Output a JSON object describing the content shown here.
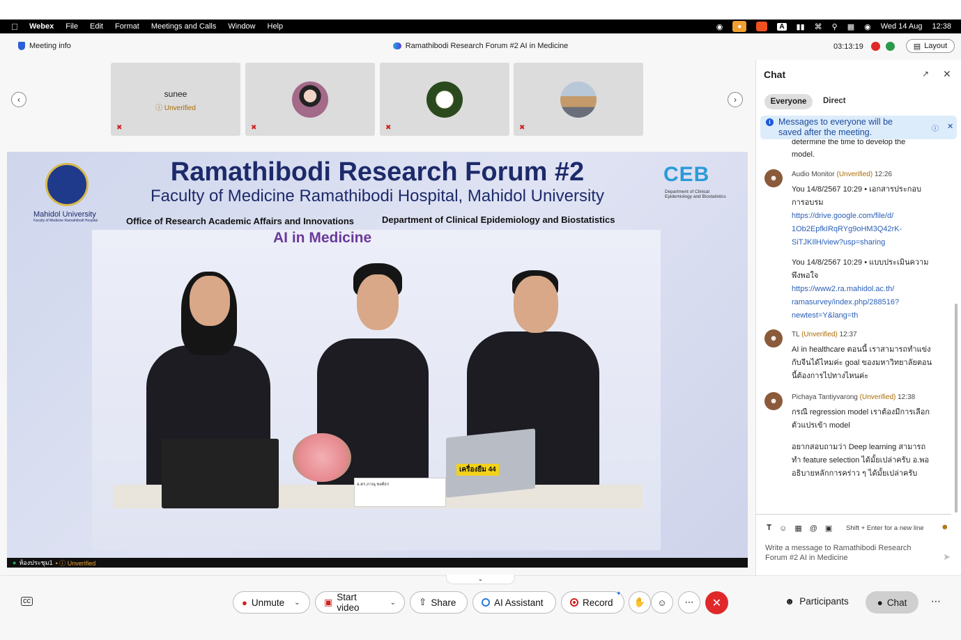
{
  "menubar": {
    "app": "Webex",
    "items": [
      "File",
      "Edit",
      "Format",
      "Meetings and Calls",
      "Window",
      "Help"
    ],
    "date": "Wed 14 Aug",
    "time": "12:38",
    "input_indicator": "A"
  },
  "titlebar": {
    "meeting_info": "Meeting info",
    "title": "Ramathibodi Research Forum #2 AI in Medicine",
    "timer": "03:13:19",
    "layout_label": "Layout"
  },
  "tiles": [
    {
      "name": "sunee",
      "status": "Unverified"
    },
    {
      "name": ""
    },
    {
      "name": ""
    },
    {
      "name": ""
    }
  ],
  "stage": {
    "banner_title": "Ramathibodi Research Forum #2",
    "banner_subtitle": "Faculty of Medicine Ramathibodi Hospital, Mahidol University",
    "office": "Office of Research Academic Affairs and Innovations",
    "department": "Department of Clinical Epidemiology and Biostatistics",
    "ai_title": "AI in Medicine",
    "mahidol": "Mahidol University",
    "mahidol_sub": "Faculty of Medicine Ramathibodi Hospital",
    "ceb_logo": "CEB",
    "ceb_dept_line1": "Department of Clinical",
    "ceb_dept_line2": "Epidemiology and Biostatistics",
    "laptop_sticker": "เครื่องยืม 44",
    "nameplate": "อ.ดร.ภาณุ พงศ์ธร",
    "label_room": "ห้องประชุม1",
    "label_status": "Unverified"
  },
  "toolbar": {
    "unmute": "Unmute",
    "start_video": "Start video",
    "share": "Share",
    "ai_assistant": "AI Assistant",
    "record": "Record",
    "participants": "Participants",
    "chat": "Chat",
    "cc": "cc"
  },
  "chat": {
    "title": "Chat",
    "tabs": {
      "everyone": "Everyone",
      "direct": "Direct"
    },
    "notice": "Messages to everyone will be saved after the meeting.",
    "messages": {
      "prev_line1": "determine the time to develop the",
      "prev_line2": "model.",
      "m1": {
        "sender": "Audio Monitor",
        "status": "(Unverified)",
        "time": "12:26",
        "l1": "You 14/8/2567 10:29 • เอกสารประกอบ",
        "l2": "การอบรม",
        "link1a": "https://drive.google.com/file/d/",
        "link1b": "1Ob2EpfkIRqRYg9oHM3Q42rK-",
        "link1c": "SiTJKIlH/view?usp=sharing",
        "l3": "You 14/8/2567 10:29 • แบบประเมินความ",
        "l4": "พึงพอใจ",
        "link2a": "https://www2.ra.mahidol.ac.th/",
        "link2b": "ramasurvey/index.php/288516?",
        "link2c": "newtest=Y&lang=th"
      },
      "m2": {
        "sender": "TL",
        "status": "(Unverified)",
        "time": "12:37",
        "l1": "AI in healthcare ตอนนี้ เราสามารถทำแข่ง",
        "l2": "กับจีนได้ไหมค่ะ goal ของมหาวิทยาลัยตอน",
        "l3": "นี้ต้องการไปทางไหนค่ะ"
      },
      "m3": {
        "sender": "Pichaya Tantiyvarong",
        "status": "(Unverified)",
        "time": "12:38",
        "l1": "กรณี regression model เราต้องมีการเลือก",
        "l2": "ตัวแปรเข้า model",
        "l3": "อยากสอบถามว่า Deep learning สามารถ",
        "l4": "ทำ feature selection ได้มั้ยเปล่าครับ อ.พอ",
        "l5": "อธิบายหลักการคร่าว ๆ ได้มั้ยเปล่าครับ"
      }
    },
    "compose_hint": "Shift + Enter for a new line",
    "compose_placeholder": "Write a message to Ramathibodi Research Forum #2 AI in Medicine"
  }
}
